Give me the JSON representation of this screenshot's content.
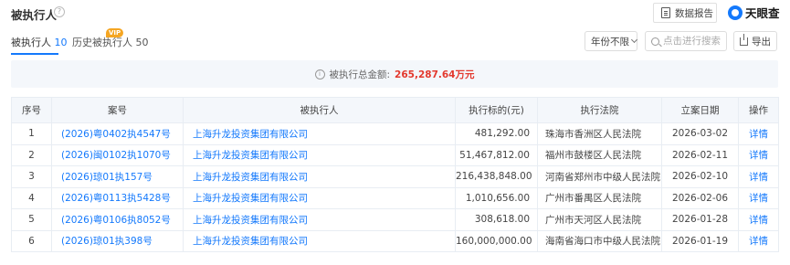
{
  "header": {
    "title": "被执行人",
    "help": "?",
    "report_label": "数据报告",
    "logo_text": "天眼查"
  },
  "tabs": {
    "current": {
      "label": "被执行人",
      "count": "10"
    },
    "history": {
      "label": "历史被执行人",
      "count": "50",
      "badge": "VIP"
    },
    "year_filter": "年份不限",
    "search_placeholder": "点击进行搜索",
    "export_label": "导出"
  },
  "summary": {
    "label": "被执行总金额:",
    "amount": "265,287.64万元"
  },
  "table": {
    "columns": [
      "序号",
      "案号",
      "被执行人",
      "执行标的(元)",
      "执行法院",
      "立案日期",
      "操作"
    ],
    "rows": [
      {
        "idx": "1",
        "case": "(2026)粤0402执4547号",
        "party": "上海升龙投资集团有限公司",
        "amount": "481,292.00",
        "court": "珠海市香洲区人民法院",
        "date": "2026-03-02",
        "op": "详情"
      },
      {
        "idx": "2",
        "case": "(2026)闽0102执1070号",
        "party": "上海升龙投资集团有限公司",
        "amount": "51,467,812.00",
        "court": "福州市鼓楼区人民法院",
        "date": "2026-02-11",
        "op": "详情"
      },
      {
        "idx": "3",
        "case": "(2026)琼01执157号",
        "party": "上海升龙投资集团有限公司",
        "amount": "216,438,848.00",
        "court": "河南省郑州市中级人民法院",
        "date": "2026-02-10",
        "op": "详情"
      },
      {
        "idx": "4",
        "case": "(2026)粤0113执5428号",
        "party": "上海升龙投资集团有限公司",
        "amount": "1,010,656.00",
        "court": "广州市番禺区人民法院",
        "date": "2026-02-06",
        "op": "详情"
      },
      {
        "idx": "5",
        "case": "(2026)粤0106执8052号",
        "party": "上海升龙投资集团有限公司",
        "amount": "308,618.00",
        "court": "广州市天河区人民法院",
        "date": "2026-01-28",
        "op": "详情"
      },
      {
        "idx": "6",
        "case": "(2026)琼01执398号",
        "party": "上海升龙投资集团有限公司",
        "amount": "160,000,000.00",
        "court": "海南省海口市中级人民法院",
        "date": "2026-01-19",
        "op": "详情"
      }
    ]
  },
  "colors": {
    "accent": "#1479fc",
    "amount_red": "#e3392e",
    "header_bg": "#f4f7fb",
    "vip_orange": "#f5a623"
  },
  "icons": [
    "help-icon",
    "report-doc-icon",
    "logo-mark-icon",
    "chevron-down-icon",
    "search-icon",
    "export-icon",
    "info-icon"
  ]
}
